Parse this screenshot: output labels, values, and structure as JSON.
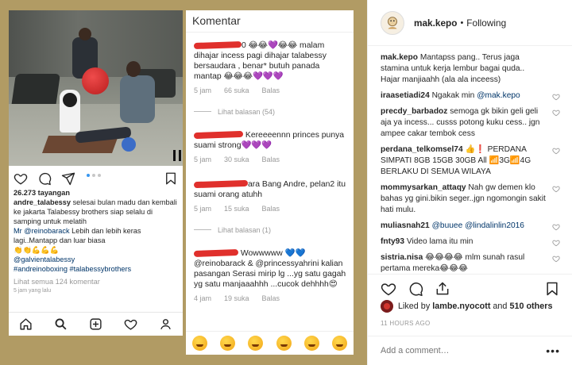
{
  "post_image": {
    "left_panel": {
      "views": "26.273 tayangan",
      "caption_user": "andre_talabessy",
      "caption_text": " selesai bulan madu dan kembali ke jakarta Talabessy brothers siap selalu di samping untuk melatih",
      "caption_mention": "Mr @reinobarack",
      "caption_text2": " Lebih dan lebih keras lagi..Mantapp dan luar biasa",
      "caption_emoji": "👏👏💪💪💪",
      "caption_tag1": "@galvientalabessy",
      "caption_tag2": "#andreinoboxing #talabessybrothers",
      "view_all": "Lihat semua 124 komentar",
      "posted": "5 jam yang lalu"
    },
    "right_panel": {
      "title": "Komentar",
      "comments": [
        {
          "text_a": "0 😂😂💜😂😂 malam dihajar incess pagi dihajar talabessy bersaudara , benar* butuh panada mantap 😂😂😂💜💜💜",
          "time": "5 jam",
          "likes": "66 suka",
          "reply": "Balas",
          "replies": "Lihat balasan (54)"
        },
        {
          "text_a": "Kereeeennn princes punya suami strong💜💜💜",
          "time": "5 jam",
          "likes": "30 suka",
          "reply": "Balas"
        },
        {
          "text_a": "ara Bang Andre, pelan2 itu suami orang atuhh",
          "time": "5 jam",
          "likes": "15 suka",
          "reply": "Balas",
          "replies": "Lihat balasan (1)"
        },
        {
          "text_a": "Wowwwww 💙💙",
          "text_b": "@reinobarack & @princessyahrini kalian pasangan Serasi mirip lg ...yg satu gagah yg satu manjaaahhh ...cucok dehhhh😍",
          "time": "4 jam",
          "likes": "19 suka",
          "reply": "Balas"
        }
      ]
    }
  },
  "sidebar": {
    "username": "mak.kepo",
    "follow_state": "Following",
    "comments": [
      {
        "user": "mak.kepo",
        "text": " Mantapss pang.. Terus jaga stamina untuk kerja lembur bagai quda.. Hajar manjiaahh (ala ala inceess)",
        "heart": false
      },
      {
        "user": "iraasetiadi24",
        "text": " Ngakak min ",
        "mention": "@mak.kepo",
        "heart": true
      },
      {
        "user": "precdy_barbadoz",
        "text": " semoga gk bikin geli geli aja ya incess... cusss potong kuku cess.. jgn ampee cakar tembok cess",
        "heart": true
      },
      {
        "user": "perdana_telkomsel74",
        "text": " 👍❗ PERDANA SIMPATI 8GB 15GB 30GB All 📶3G📶4G BERLAKU DI SEMUA WILAYA",
        "heart": true
      },
      {
        "user": "mommysarkan_attaqy",
        "text": " Nah gw demen klo bahas yg gini.bikin seger..jgn ngomongin sakit hati mulu.",
        "heart": true
      },
      {
        "user": "muliasnah21",
        "text": " ",
        "mention": "@buuee @lindalinlin2016",
        "heart": true
      },
      {
        "user": "fnty93",
        "text": " Video lama itu min",
        "heart": true
      },
      {
        "user": "sistria.nisa",
        "text": " 😂😂😂😂 mlm sunah rasul pertama mereka😂😂😂",
        "heart": true
      }
    ],
    "liked_by_prefix": "Liked by ",
    "liked_by_user": "lambe.nyocott",
    "liked_by_and": " and ",
    "liked_by_count": "510 others",
    "timestamp": "11 HOURS AGO",
    "add_comment_placeholder": "Add a comment…",
    "more": "•••"
  }
}
